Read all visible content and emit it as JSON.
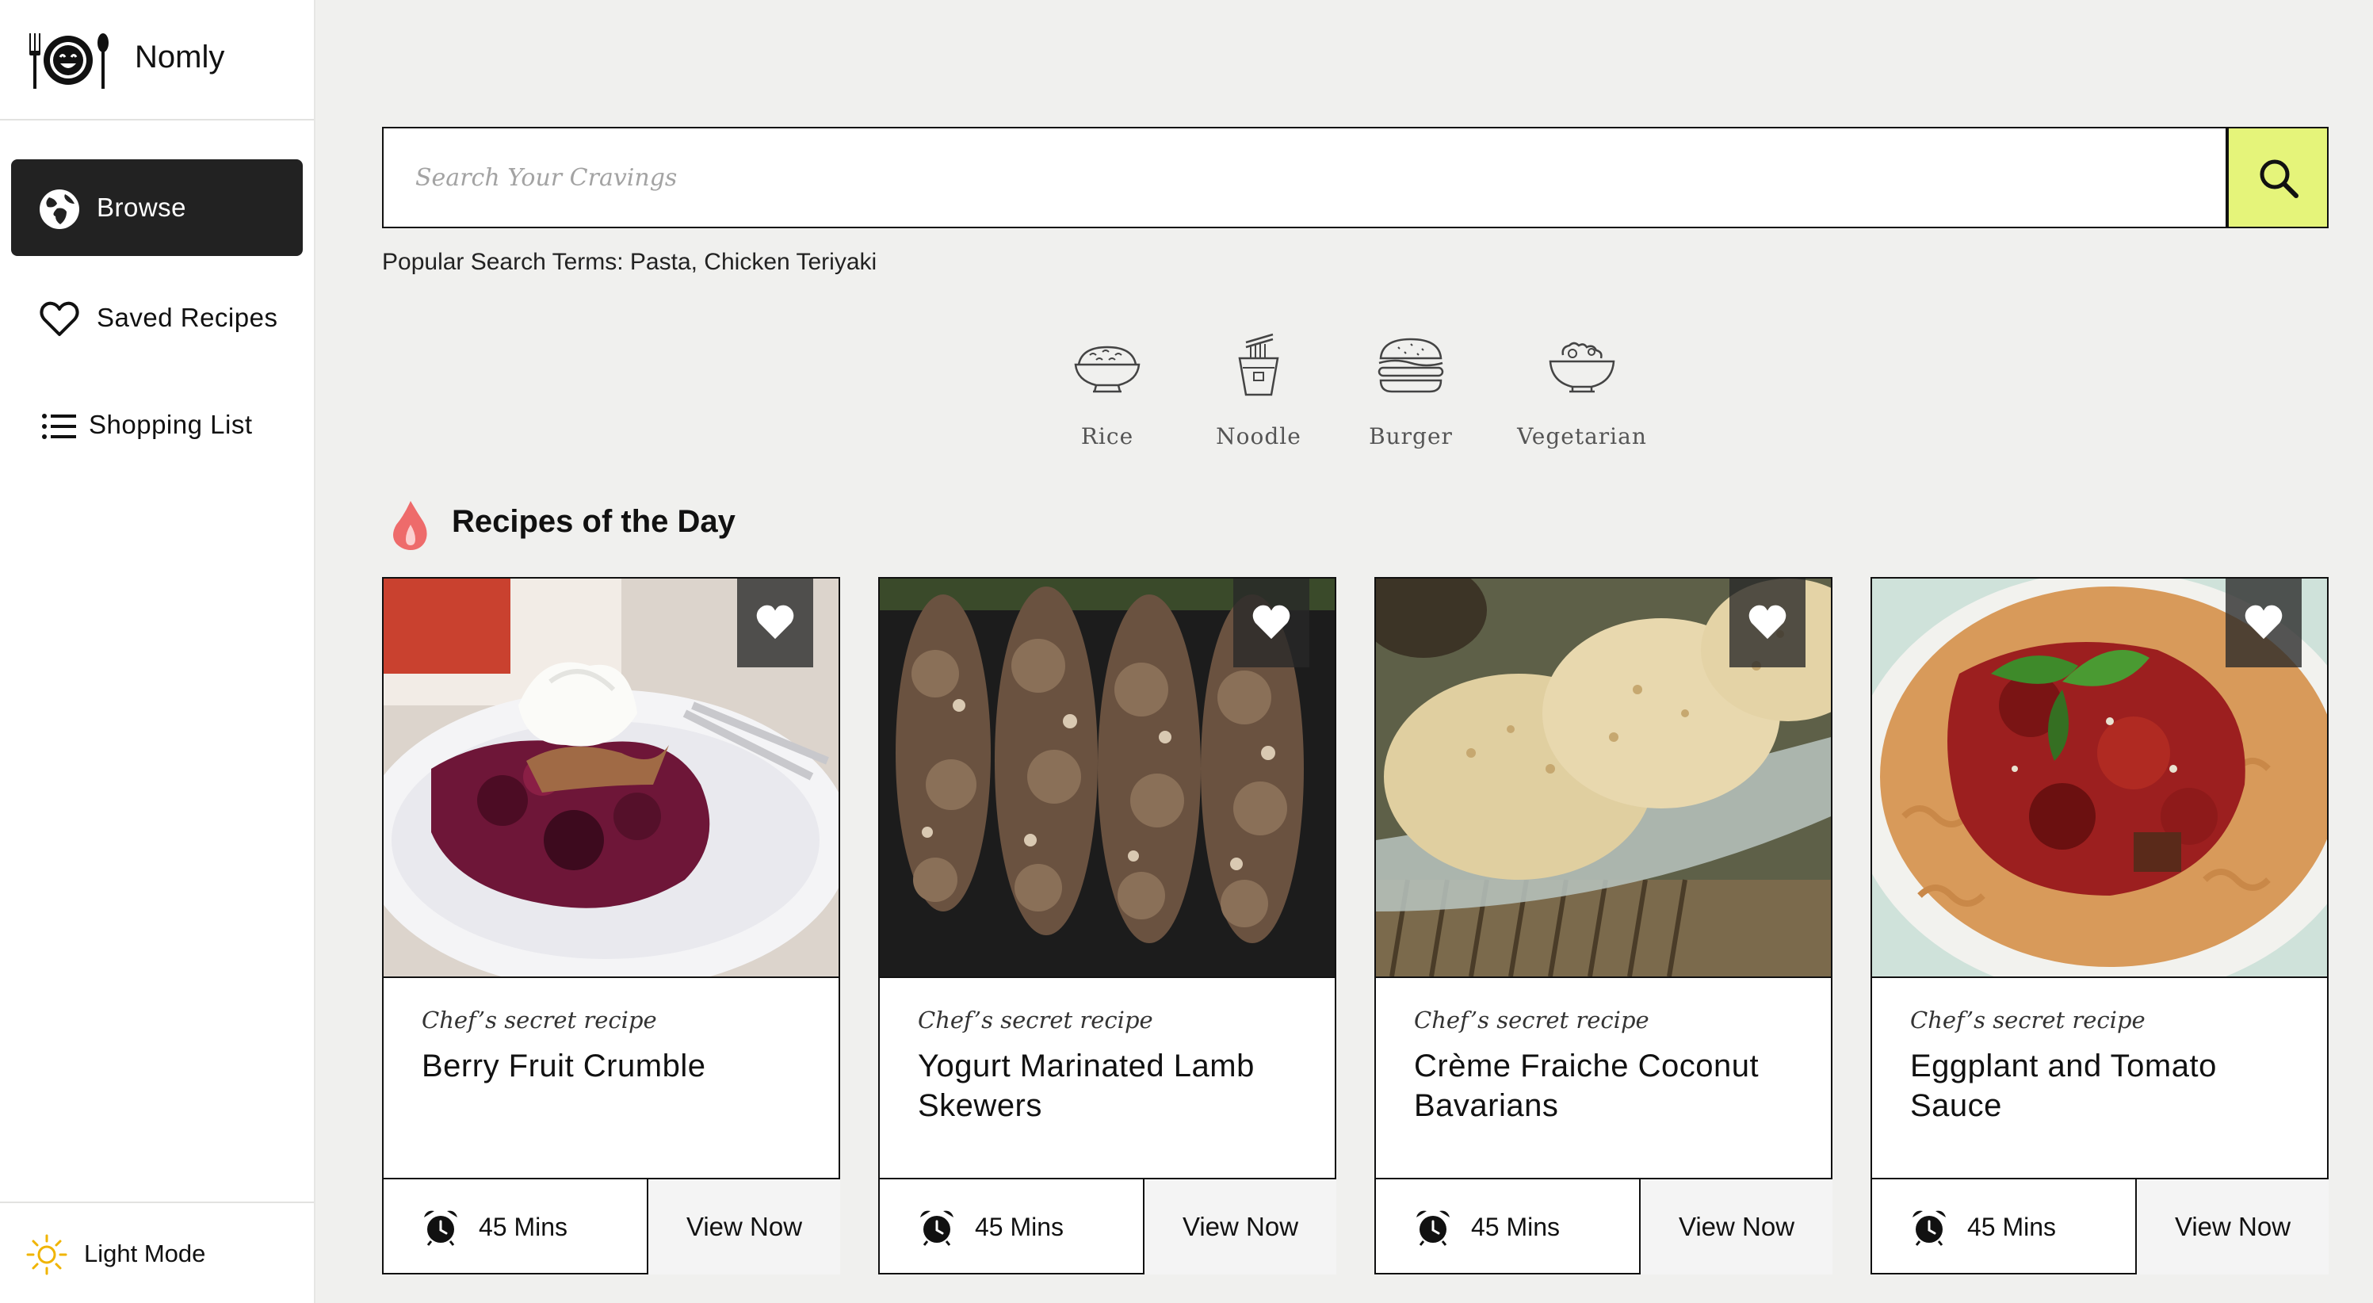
{
  "app": {
    "name": "Nomly"
  },
  "sidebar": {
    "items": [
      {
        "label": "Browse",
        "icon": "globe-icon",
        "active": true
      },
      {
        "label": "Saved Recipes",
        "icon": "heart-icon",
        "active": false
      },
      {
        "label": "Shopping List",
        "icon": "list-icon",
        "active": false
      }
    ],
    "theme_toggle": {
      "label": "Light Mode",
      "icon": "sun-icon"
    }
  },
  "search": {
    "placeholder": "Search Your Cravings",
    "value": "",
    "popular": "Popular Search Terms: Pasta, Chicken Teriyaki"
  },
  "categories": [
    {
      "label": "Rice",
      "icon": "rice-bowl-icon"
    },
    {
      "label": "Noodle",
      "icon": "noodle-box-icon"
    },
    {
      "label": "Burger",
      "icon": "burger-icon"
    },
    {
      "label": "Vegetarian",
      "icon": "salad-bowl-icon"
    }
  ],
  "section": {
    "title": "Recipes of the Day",
    "icon": "flame-icon"
  },
  "recipes": [
    {
      "tag": "Chef’s secret recipe",
      "title": "Berry Fruit Crumble",
      "time": "45 Mins",
      "action": "View Now"
    },
    {
      "tag": "Chef’s secret recipe",
      "title": "Yogurt Marinated Lamb Skewers",
      "time": "45 Mins",
      "action": "View Now"
    },
    {
      "tag": "Chef’s secret recipe",
      "title": "Crème Fraiche Coconut Bavarians",
      "time": "45 Mins",
      "action": "View Now"
    },
    {
      "tag": "Chef’s secret recipe",
      "title": "Eggplant and Tomato Sauce",
      "time": "45 Mins",
      "action": "View Now"
    }
  ],
  "colors": {
    "accent": "#e5f47a",
    "active_nav": "#222222",
    "flame": "#ee6b6b",
    "background": "#f0f0ee"
  }
}
